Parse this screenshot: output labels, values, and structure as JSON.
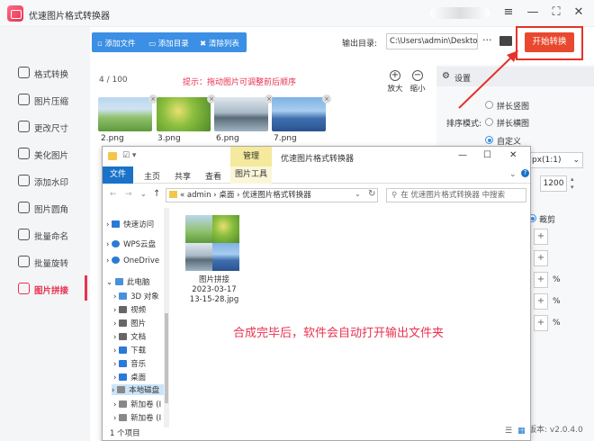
{
  "app": {
    "title": "优速图片格式转换器",
    "window_controls": [
      "≡",
      "—",
      "⛶",
      "✕"
    ]
  },
  "sidebar": {
    "items": [
      {
        "label": "格式转换",
        "icon": "format-convert-icon"
      },
      {
        "label": "图片压缩",
        "icon": "compress-icon"
      },
      {
        "label": "更改尺寸",
        "icon": "resize-icon"
      },
      {
        "label": "美化图片",
        "icon": "beautify-icon"
      },
      {
        "label": "添加水印",
        "icon": "watermark-icon"
      },
      {
        "label": "图片圆角",
        "icon": "rounded-corner-icon"
      },
      {
        "label": "批量命名",
        "icon": "rename-icon"
      },
      {
        "label": "批量旋转",
        "icon": "rotate-icon"
      },
      {
        "label": "图片拼接",
        "icon": "stitch-icon"
      }
    ],
    "active": "图片拼接"
  },
  "toolbar": {
    "add_file": "添加文件",
    "add_dir": "添加目录",
    "clear": "清除列表"
  },
  "output": {
    "label": "输出目录:",
    "path": "C:\\Users\\admin\\Deskto",
    "more": "···"
  },
  "start_button": "开始转换",
  "list": {
    "count": "4 / 100",
    "hint": "提示：拖动图片可调整前后顺序",
    "zoom_in": "放大",
    "zoom_out": "缩小",
    "files": [
      "2.png",
      "3.png",
      "6.png",
      "7.png"
    ]
  },
  "settings": {
    "title": "设置",
    "order_label": "排序模式:",
    "options": [
      "拼长竖图",
      "拼长横图",
      "自定义"
    ],
    "selected": "自定义",
    "ratio": "px(1:1)",
    "width": "1200",
    "crop": "裁剪",
    "units": [
      "%",
      "%",
      "%"
    ]
  },
  "explorer": {
    "title": "优速图片格式转换器",
    "manage": "管理",
    "tabs": [
      "文件",
      "主页",
      "共享",
      "查看"
    ],
    "picture_tools": "图片工具",
    "window_controls": [
      "—",
      "☐",
      "✕"
    ],
    "address": [
      "admin",
      "桌面",
      "优速图片格式转换器"
    ],
    "search_placeholder": "在 优速图片格式转换器 中搜索",
    "nav": [
      {
        "label": "快速访问",
        "color": "#2b79d8"
      },
      {
        "label": "WPS云盘",
        "color": "#2b79d8"
      },
      {
        "label": "OneDrive",
        "color": "#2b79d8"
      },
      {
        "label": "此电脑",
        "color": "#4a90d9"
      },
      {
        "label": "3D 对象",
        "color": "#4a90d9"
      },
      {
        "label": "视频",
        "color": "#666666"
      },
      {
        "label": "图片",
        "color": "#666666"
      },
      {
        "label": "文档",
        "color": "#666666"
      },
      {
        "label": "下载",
        "color": "#2b79d8"
      },
      {
        "label": "音乐",
        "color": "#2b79d8"
      },
      {
        "label": "桌面",
        "color": "#2b79d8"
      },
      {
        "label": "本地磁盘",
        "color": "#888888"
      },
      {
        "label": "新加卷 (I",
        "color": "#888888"
      },
      {
        "label": "新加卷 (I",
        "color": "#888888"
      }
    ],
    "file": {
      "name": "图片拼接",
      "date": "2023-03-17",
      "time": "13-15-28.jpg"
    },
    "status": "1 个项目"
  },
  "caption": "合成完毕后，软件会自动打开输出文件夹",
  "version": "版本: v2.0.4.0",
  "colors": {
    "accent_red": "#e8324f",
    "toolbar_blue": "#3b8fe4",
    "start_btn": "#e8492e"
  }
}
